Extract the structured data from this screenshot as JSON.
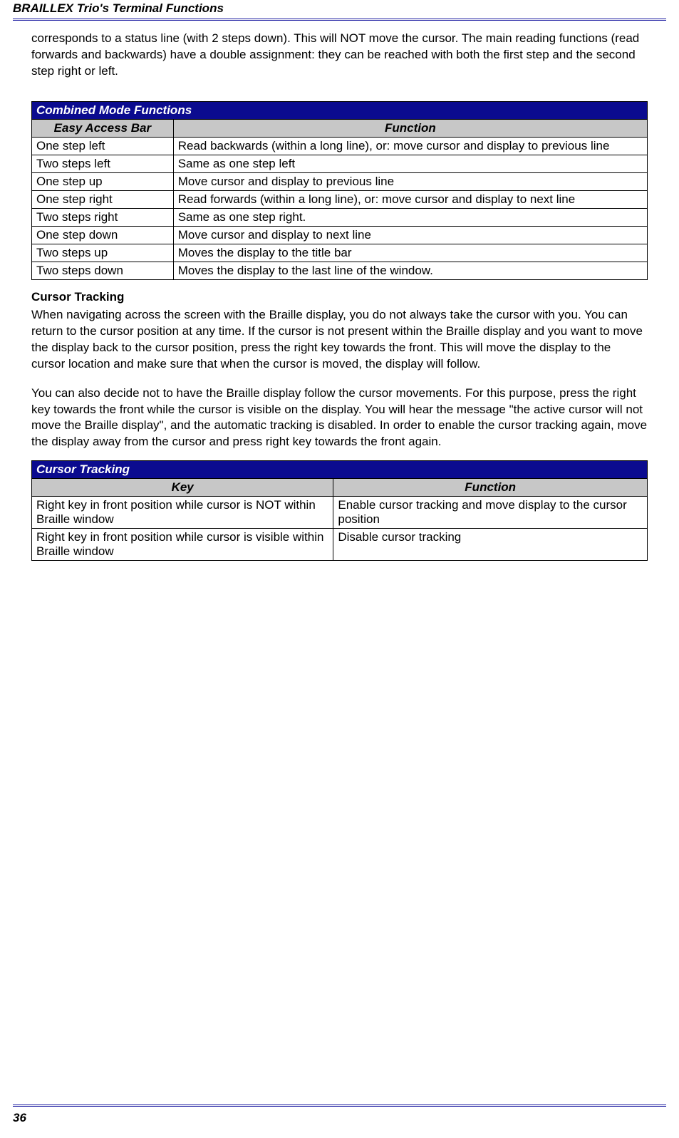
{
  "header": {
    "running_title": "BRAILLEX Trio's Terminal Functions"
  },
  "intro": {
    "paragraph": "corresponds to a status line (with 2 steps down). This will NOT move the cursor. The main reading functions (read forwards and backwards) have a double assignment: they can be reached with both the first step and the second step right or left."
  },
  "table1": {
    "title": "Combined Mode Functions",
    "col1": "Easy Access Bar",
    "col2": "Function",
    "rows": [
      {
        "key": "One step left",
        "fn": "Read backwards (within a long line), or: move cursor and display to previous line"
      },
      {
        "key": "Two steps left",
        "fn": "Same as one step left"
      },
      {
        "key": "One step up",
        "fn": "Move cursor and display to previous line"
      },
      {
        "key": "One step right",
        "fn": "Read forwards (within a long line), or: move cursor and display to next line"
      },
      {
        "key": "Two steps right",
        "fn": "Same as one step right."
      },
      {
        "key": "One step down",
        "fn": "Move cursor and display to next line"
      },
      {
        "key": "Two steps up",
        "fn": "Moves the display to the title bar"
      },
      {
        "key": "Two steps down",
        "fn": "Moves the display to the last line of the window."
      }
    ]
  },
  "cursor": {
    "heading": "Cursor Tracking",
    "p1": "When navigating across the screen with the Braille display, you do not always take the cursor with you. You can return to the cursor position at any time. If the cursor is not present within the Braille display and you want to move the display back to the cursor position, press the right key towards the front. This will move the display to the cursor location and make sure that when the cursor is moved, the display will follow.",
    "p2": "You can also decide not to have the Braille display follow the cursor movements. For this purpose, press the right key towards the front while the cursor is visible on the display. You will hear the message \"the active cursor will not move the Braille display\", and the automatic tracking is disabled. In order to enable the cursor tracking again, move the display away from the cursor and press right key towards the front again."
  },
  "table2": {
    "title": "Cursor Tracking",
    "col1": "Key",
    "col2": "Function",
    "rows": [
      {
        "key": "Right key in front position while cursor is NOT within Braille window",
        "fn": "Enable cursor tracking and move display to the cursor position"
      },
      {
        "key": "Right key in front position while cursor is visible within Braille window",
        "fn": "Disable cursor tracking"
      }
    ]
  },
  "footer": {
    "page_number": "36"
  }
}
